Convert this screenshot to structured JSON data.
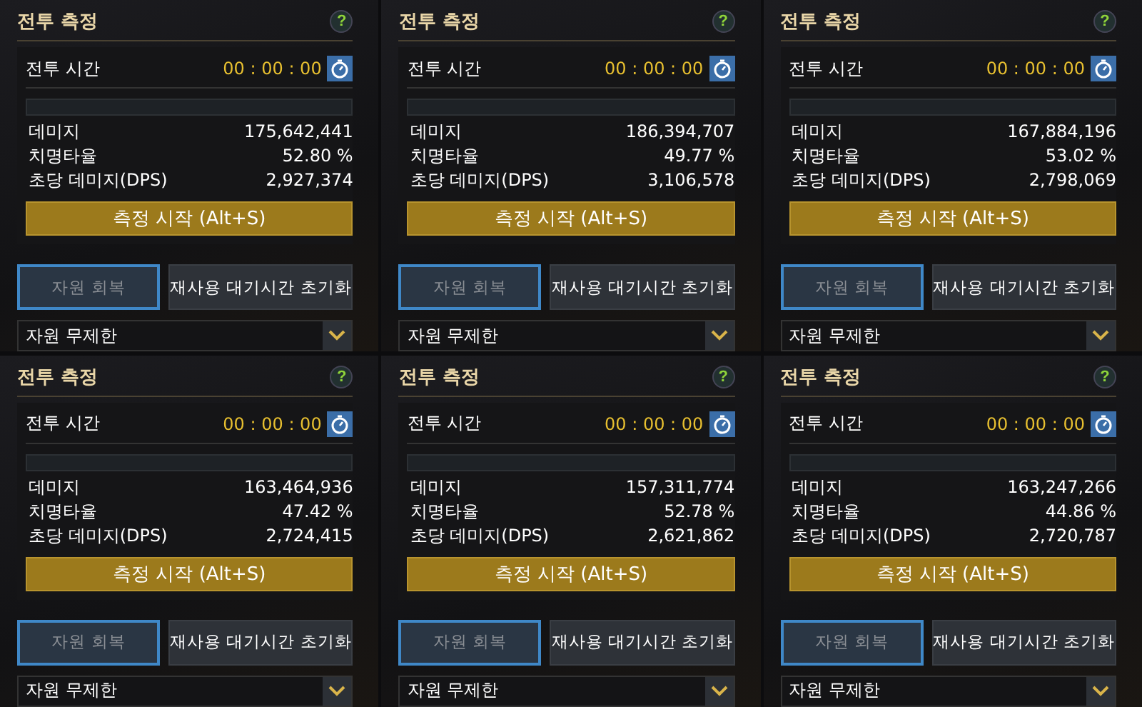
{
  "panels": [
    {
      "title": "전투 측정",
      "help": "?",
      "time_label": "전투 시간",
      "time": "00 : 00 : 00",
      "stats": [
        {
          "label": "데미지",
          "value": "175,642,441"
        },
        {
          "label": "치명타율",
          "value": "52.80 %"
        },
        {
          "label": "초당 데미지(DPS)",
          "value": "2,927,374"
        }
      ],
      "start_button": "측정 시작 (Alt+S)",
      "buttons": [
        {
          "label": "자원 회복",
          "disabled": true
        },
        {
          "label": "재사용 대기시간 초기화",
          "disabled": false
        }
      ],
      "dropdown": "자원 무제한"
    },
    {
      "title": "전투 측정",
      "help": "?",
      "time_label": "전투 시간",
      "time": "00 : 00 : 00",
      "stats": [
        {
          "label": "데미지",
          "value": "186,394,707"
        },
        {
          "label": "치명타율",
          "value": "49.77 %"
        },
        {
          "label": "초당 데미지(DPS)",
          "value": "3,106,578"
        }
      ],
      "start_button": "측정 시작 (Alt+S)",
      "buttons": [
        {
          "label": "자원 회복",
          "disabled": true
        },
        {
          "label": "재사용 대기시간 초기화",
          "disabled": false
        }
      ],
      "dropdown": "자원 무제한"
    },
    {
      "title": "전투 측정",
      "help": "?",
      "time_label": "전투 시간",
      "time": "00 : 00 : 00",
      "stats": [
        {
          "label": "데미지",
          "value": "167,884,196"
        },
        {
          "label": "치명타율",
          "value": "53.02 %"
        },
        {
          "label": "초당 데미지(DPS)",
          "value": "2,798,069"
        }
      ],
      "start_button": "측정 시작 (Alt+S)",
      "buttons": [
        {
          "label": "자원 회복",
          "disabled": true
        },
        {
          "label": "재사용 대기시간 초기화",
          "disabled": false
        }
      ],
      "dropdown": "자원 무제한"
    },
    {
      "title": "전투 측정",
      "help": "?",
      "time_label": "전투 시간",
      "time": "00 : 00 : 00",
      "stats": [
        {
          "label": "데미지",
          "value": "163,464,936"
        },
        {
          "label": "치명타율",
          "value": "47.42 %"
        },
        {
          "label": "초당 데미지(DPS)",
          "value": "2,724,415"
        }
      ],
      "start_button": "측정 시작 (Alt+S)",
      "buttons": [
        {
          "label": "자원 회복",
          "disabled": true
        },
        {
          "label": "재사용 대기시간 초기화",
          "disabled": false
        }
      ],
      "dropdown": "자원 무제한"
    },
    {
      "title": "전투 측정",
      "help": "?",
      "time_label": "전투 시간",
      "time": "00 : 00 : 00",
      "stats": [
        {
          "label": "데미지",
          "value": "157,311,774"
        },
        {
          "label": "치명타율",
          "value": "52.78 %"
        },
        {
          "label": "초당 데미지(DPS)",
          "value": "2,621,862"
        }
      ],
      "start_button": "측정 시작 (Alt+S)",
      "buttons": [
        {
          "label": "자원 회복",
          "disabled": true
        },
        {
          "label": "재사용 대기시간 초기화",
          "disabled": false
        }
      ],
      "dropdown": "자원 무제한"
    },
    {
      "title": "전투 측정",
      "help": "?",
      "time_label": "전투 시간",
      "time": "00 : 00 : 00",
      "stats": [
        {
          "label": "데미지",
          "value": "163,247,266"
        },
        {
          "label": "치명타율",
          "value": "44.86 %"
        },
        {
          "label": "초당 데미지(DPS)",
          "value": "2,720,787"
        }
      ],
      "start_button": "측정 시작 (Alt+S)",
      "buttons": [
        {
          "label": "자원 회복",
          "disabled": true
        },
        {
          "label": "재사용 대기시간 초기화",
          "disabled": false
        }
      ],
      "dropdown": "자원 무제한"
    }
  ]
}
